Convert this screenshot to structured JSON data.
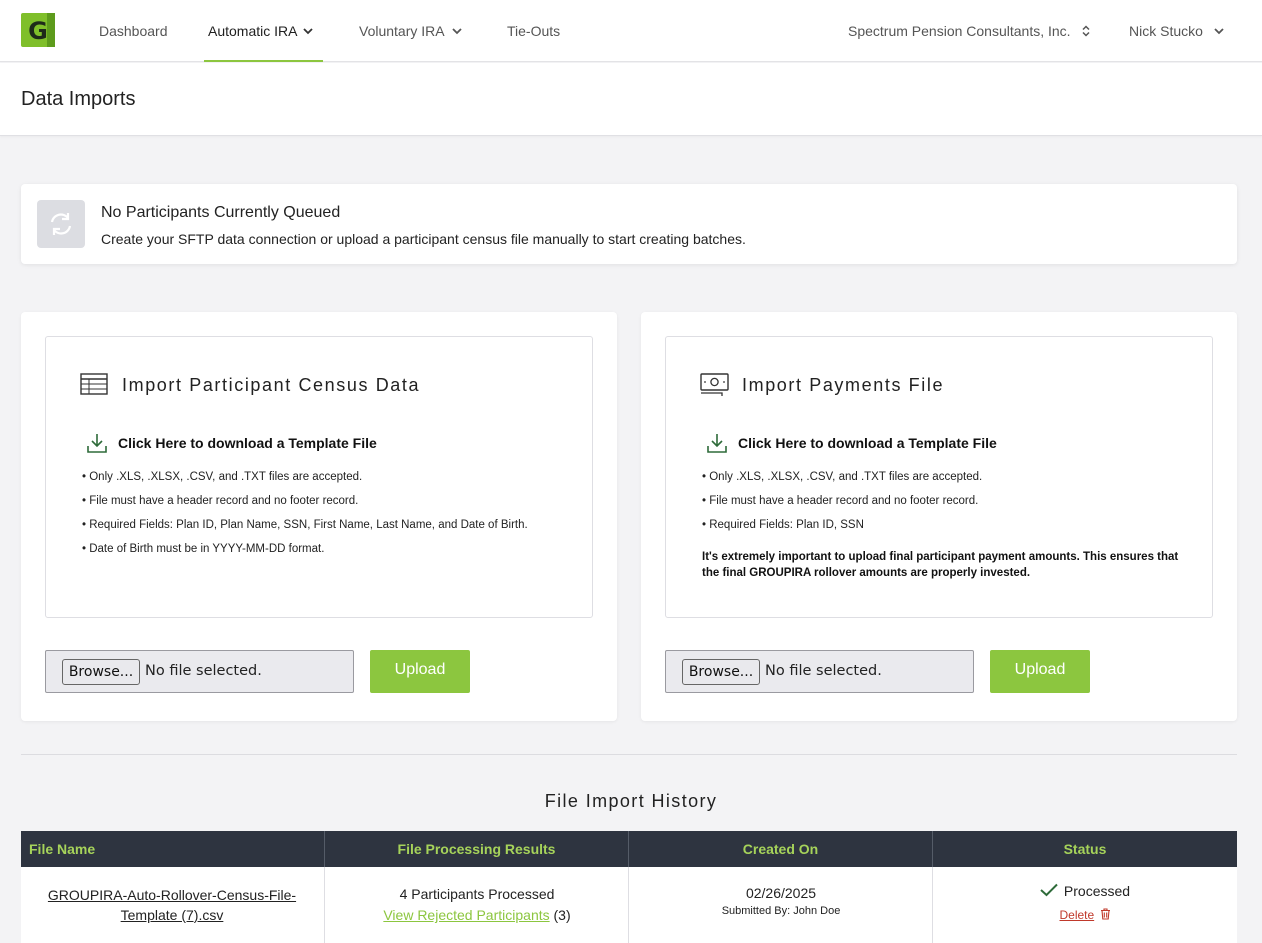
{
  "nav": {
    "logo_letter": "G",
    "items": [
      {
        "label": "Dashboard",
        "dropdown": false
      },
      {
        "label": "Automatic IRA",
        "dropdown": true,
        "active": true
      },
      {
        "label": "Voluntary IRA",
        "dropdown": true
      },
      {
        "label": "Tie-Outs",
        "dropdown": false
      }
    ],
    "organization": "Spectrum Pension Consultants, Inc.",
    "user": "Nick Stucko"
  },
  "page": {
    "title": "Data Imports"
  },
  "queue_banner": {
    "title": "No Participants Currently Queued",
    "subtitle": "Create your SFTP data connection or upload a participant census file manually to start creating batches.",
    "icon": "refresh-icon"
  },
  "census_card": {
    "title": "Import Participant Census Data",
    "icon": "table-icon",
    "download_label": "Click Here to download a Template File",
    "rules": [
      "Only .XLS, .XLSX, .CSV, and .TXT files are accepted.",
      "File must have a header record and no footer record.",
      "Required Fields: Plan ID, Plan Name, SSN, First Name, Last Name, and Date of Birth.",
      "Date of Birth must be in YYYY-MM-DD format."
    ],
    "browse_label": "Browse...",
    "file_status": "No file selected.",
    "upload_label": "Upload"
  },
  "payments_card": {
    "title": "Import Payments File",
    "icon": "money-icon",
    "download_label": "Click Here to download a Template File",
    "rules": [
      "Only .XLS, .XLSX, .CSV, and .TXT files are accepted.",
      "File must have a header record and no footer record.",
      "Required Fields: Plan ID, SSN"
    ],
    "note": "It's extremely important to upload final participant payment amounts. This ensures that the final GROUPIRA rollover amounts are properly invested.",
    "browse_label": "Browse...",
    "file_status": "No file selected.",
    "upload_label": "Upload"
  },
  "history": {
    "title": "File Import History",
    "columns": [
      "File Name",
      "File Processing Results",
      "Created On",
      "Status"
    ],
    "rows": [
      {
        "file_name": "GROUPIRA-Auto-Rollover-Census-File-Template (7).csv",
        "processed": "4 Participants Processed",
        "rejected_link": "View Rejected Participants",
        "rejected_count": "(3)",
        "created_on": "02/26/2025",
        "submitted_by": "Submitted By: John Doe",
        "status": "Processed",
        "delete_label": "Delete"
      }
    ]
  },
  "colors": {
    "accent": "#8cc63f",
    "table_header_bg": "#2e3440",
    "delete_red": "#c0392b"
  }
}
